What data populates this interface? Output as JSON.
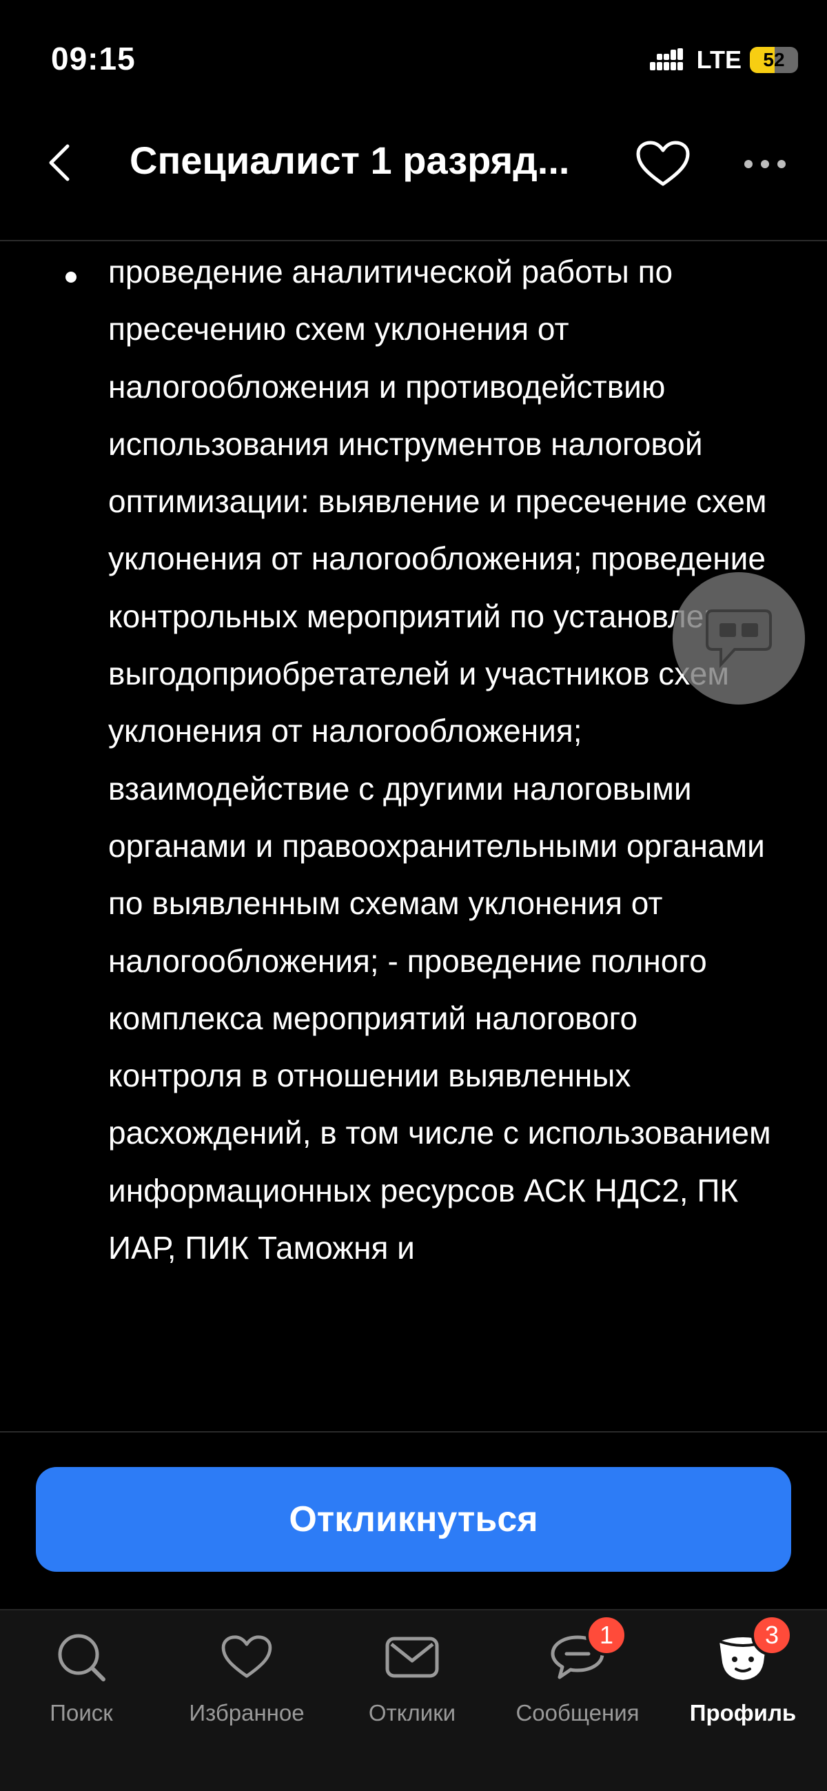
{
  "status_bar": {
    "time": "09:15",
    "network": "LTE",
    "battery": "52",
    "battery_level": 0.52
  },
  "header": {
    "title": "Специалист 1 разряд...",
    "back_icon": "chevron-left-icon",
    "favorite_icon": "heart-icon",
    "more_icon": "more-horizontal-icon"
  },
  "content": {
    "bullets": [
      "проведение аналитической работы по пресечению схем уклонения от налогообложения и противодействию использования инструментов налоговой оптимизации: выявление и пресечение схем уклонения от налогообложения; проведение контрольных мероприятий по установлению выгодоприобретателей и участников схем уклонения от налогообложения; взаимодействие с другими налоговыми органами и правоохранительными органами по выявленным схемам уклонения от налогообложения; - проведение полного комплекса мероприятий налогового контроля в отношении выявленных расхождений, в том числе с использованием информационных ресурсов АСК НДС2, ПК ИАР, ПИК Таможня и"
    ]
  },
  "chat_fab_icon": "chat-bubble-icon",
  "apply_button": {
    "label": "Откликнуться",
    "color": "#2d7cf6"
  },
  "tab_bar": {
    "tabs": [
      {
        "label": "Поиск",
        "icon": "search-icon"
      },
      {
        "label": "Избранное",
        "icon": "heart-icon"
      },
      {
        "label": "Отклики",
        "icon": "envelope-icon"
      },
      {
        "label": "Сообщения",
        "icon": "message-icon",
        "badge": "1"
      },
      {
        "label": "Профиль",
        "icon": "profile-mascot-icon",
        "badge": "3",
        "active": true
      }
    ],
    "badge_color": "#ff4b3a"
  }
}
